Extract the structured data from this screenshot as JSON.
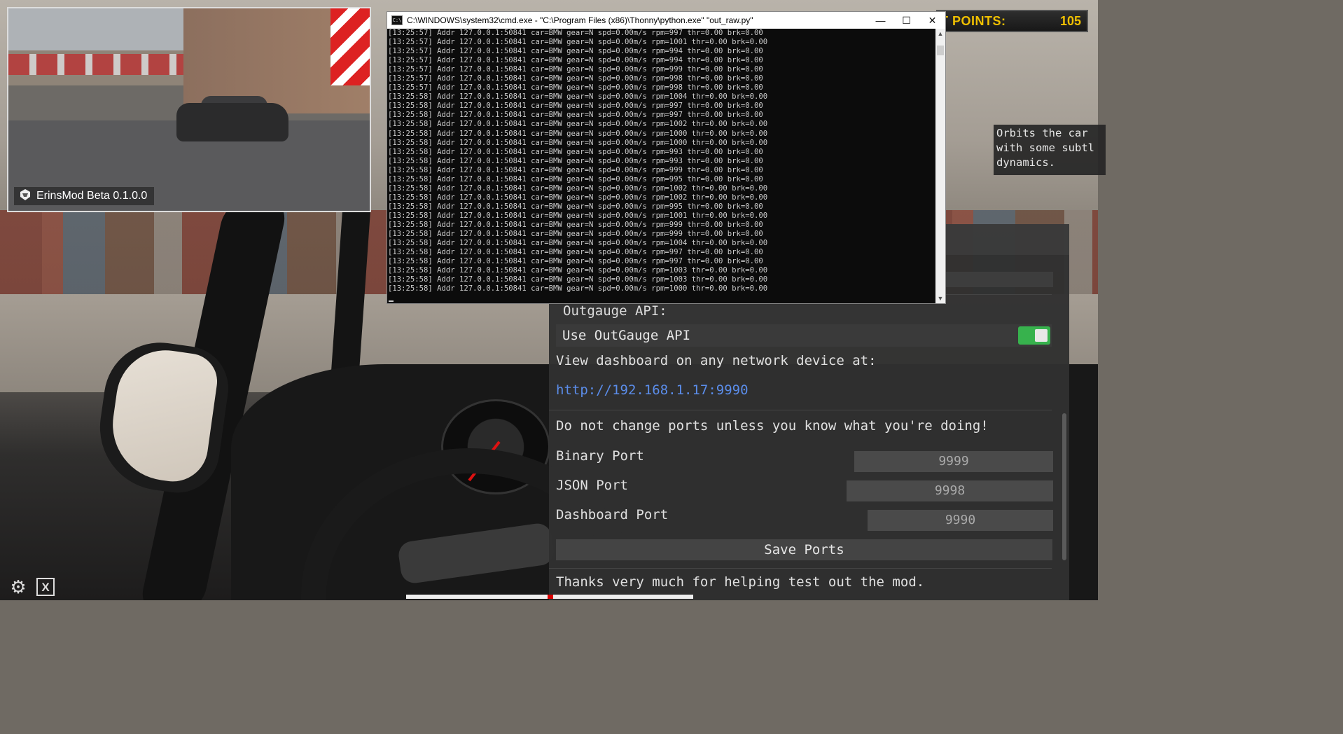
{
  "hud": {
    "points_label": "T POINTS:",
    "points_value": "105",
    "tooltip": "Orbits the car\nwith some subtl\ndynamics."
  },
  "preview": {
    "caption": "ErinsMod Beta 0.1.0.0"
  },
  "cmd": {
    "title": "C:\\WINDOWS\\system32\\cmd.exe - \"C:\\Program Files (x86)\\Thonny\\python.exe\"  \"out_raw.py\"",
    "minimize": "—",
    "maximize": "☐",
    "close": "✕",
    "lines": [
      "[13:25:57] Addr 127.0.0.1:50841 car=BMW gear=N spd=0.00m/s rpm=997 thr=0.00 brk=0.00",
      "[13:25:57] Addr 127.0.0.1:50841 car=BMW gear=N spd=0.00m/s rpm=1001 thr=0.00 brk=0.00",
      "[13:25:57] Addr 127.0.0.1:50841 car=BMW gear=N spd=0.00m/s rpm=994 thr=0.00 brk=0.00",
      "[13:25:57] Addr 127.0.0.1:50841 car=BMW gear=N spd=0.00m/s rpm=994 thr=0.00 brk=0.00",
      "[13:25:57] Addr 127.0.0.1:50841 car=BMW gear=N spd=0.00m/s rpm=999 thr=0.00 brk=0.00",
      "[13:25:57] Addr 127.0.0.1:50841 car=BMW gear=N spd=0.00m/s rpm=998 thr=0.00 brk=0.00",
      "[13:25:57] Addr 127.0.0.1:50841 car=BMW gear=N spd=0.00m/s rpm=998 thr=0.00 brk=0.00",
      "[13:25:58] Addr 127.0.0.1:50841 car=BMW gear=N spd=0.00m/s rpm=1004 thr=0.00 brk=0.00",
      "[13:25:58] Addr 127.0.0.1:50841 car=BMW gear=N spd=0.00m/s rpm=997 thr=0.00 brk=0.00",
      "[13:25:58] Addr 127.0.0.1:50841 car=BMW gear=N spd=0.00m/s rpm=997 thr=0.00 brk=0.00",
      "[13:25:58] Addr 127.0.0.1:50841 car=BMW gear=N spd=0.00m/s rpm=1002 thr=0.00 brk=0.00",
      "[13:25:58] Addr 127.0.0.1:50841 car=BMW gear=N spd=0.00m/s rpm=1000 thr=0.00 brk=0.00",
      "[13:25:58] Addr 127.0.0.1:50841 car=BMW gear=N spd=0.00m/s rpm=1000 thr=0.00 brk=0.00",
      "[13:25:58] Addr 127.0.0.1:50841 car=BMW gear=N spd=0.00m/s rpm=993 thr=0.00 brk=0.00",
      "[13:25:58] Addr 127.0.0.1:50841 car=BMW gear=N spd=0.00m/s rpm=993 thr=0.00 brk=0.00",
      "[13:25:58] Addr 127.0.0.1:50841 car=BMW gear=N spd=0.00m/s rpm=999 thr=0.00 brk=0.00",
      "[13:25:58] Addr 127.0.0.1:50841 car=BMW gear=N spd=0.00m/s rpm=995 thr=0.00 brk=0.00",
      "[13:25:58] Addr 127.0.0.1:50841 car=BMW gear=N spd=0.00m/s rpm=1002 thr=0.00 brk=0.00",
      "[13:25:58] Addr 127.0.0.1:50841 car=BMW gear=N spd=0.00m/s rpm=1002 thr=0.00 brk=0.00",
      "[13:25:58] Addr 127.0.0.1:50841 car=BMW gear=N spd=0.00m/s rpm=995 thr=0.00 brk=0.00",
      "[13:25:58] Addr 127.0.0.1:50841 car=BMW gear=N spd=0.00m/s rpm=1001 thr=0.00 brk=0.00",
      "[13:25:58] Addr 127.0.0.1:50841 car=BMW gear=N spd=0.00m/s rpm=999 thr=0.00 brk=0.00",
      "[13:25:58] Addr 127.0.0.1:50841 car=BMW gear=N spd=0.00m/s rpm=999 thr=0.00 brk=0.00",
      "[13:25:58] Addr 127.0.0.1:50841 car=BMW gear=N spd=0.00m/s rpm=1004 thr=0.00 brk=0.00",
      "[13:25:58] Addr 127.0.0.1:50841 car=BMW gear=N spd=0.00m/s rpm=997 thr=0.00 brk=0.00",
      "[13:25:58] Addr 127.0.0.1:50841 car=BMW gear=N spd=0.00m/s rpm=997 thr=0.00 brk=0.00",
      "[13:25:58] Addr 127.0.0.1:50841 car=BMW gear=N spd=0.00m/s rpm=1003 thr=0.00 brk=0.00",
      "[13:25:58] Addr 127.0.0.1:50841 car=BMW gear=N spd=0.00m/s rpm=1003 thr=0.00 brk=0.00",
      "[13:25:58] Addr 127.0.0.1:50841 car=BMW gear=N spd=0.00m/s rpm=1000 thr=0.00 brk=0.00"
    ]
  },
  "panel": {
    "section_title": "Outgauge API:",
    "toggle_label": "Use OutGauge API",
    "toggle_on": true,
    "dashboard_text": "View dashboard on any network device at:",
    "dashboard_url": "http://192.168.1.17:9990",
    "warning": "Do not change ports unless you know what you're doing!",
    "binary_port_label": "Binary Port",
    "binary_port_value": "9999",
    "json_port_label": "JSON Port",
    "json_port_value": "9998",
    "dashboard_port_label": "Dashboard Port",
    "dashboard_port_value": "9990",
    "save_label": "Save Ports",
    "thanks": "Thanks very much for helping test out the mod."
  },
  "colors": {
    "accent_link": "#5b8dea",
    "toggle_on": "#37b24d",
    "points": "#f0c000"
  }
}
